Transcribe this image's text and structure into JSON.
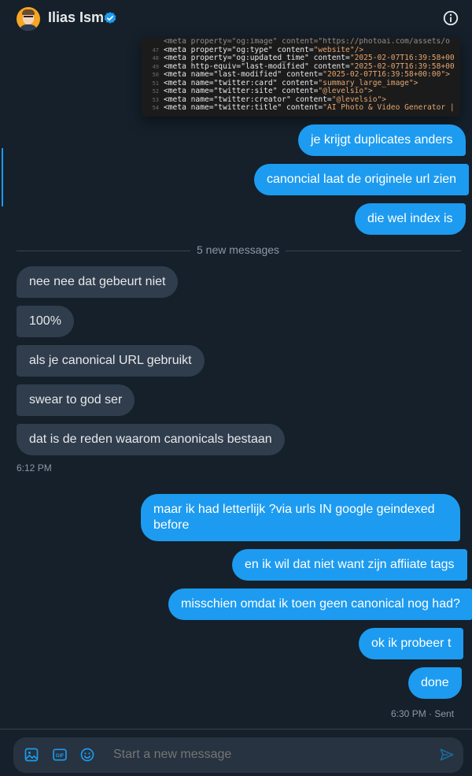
{
  "header": {
    "user_name": "Ilias Ism",
    "verified_icon": "verified-badge-icon",
    "info_icon": "info-icon",
    "accent": "#1d9bf0"
  },
  "code_snippet": {
    "lines": [
      {
        "num": "47",
        "tag": "<meta property=\"og:type\" content=",
        "value": "\"website\"/>"
      },
      {
        "num": "48",
        "tag": "<meta property=\"og:updated_time\" content=",
        "value": "\"2025-02-07T16:39:58+00"
      },
      {
        "num": "49",
        "tag": "<meta http-equiv=\"last-modified\" content=",
        "value": "\"2025-02-07T16:39:58+00"
      },
      {
        "num": "50",
        "tag": "<meta name=\"last-modified\" content=",
        "value": "\"2025-02-07T16:39:58+00:00\">"
      },
      {
        "num": "51",
        "tag": "<meta name=\"twitter:card\" content=",
        "value": "\"summary_large_image\">"
      },
      {
        "num": "52",
        "tag": "<meta name=\"twitter:site\" content=",
        "value": "\"@levelsio\">"
      },
      {
        "num": "53",
        "tag": "<meta name=\"twitter:creator\" content=",
        "value": "\"@levelsio\">"
      },
      {
        "num": "54",
        "tag": "<meta name=\"twitter:title\" content=",
        "value": "\"AI Photo & Video Generator |"
      }
    ]
  },
  "messages_top": [
    "je krijgt duplicates anders",
    "canoncial laat de originele url zien",
    "die wel index is"
  ],
  "divider_label": "5 new messages",
  "messages_in": [
    "nee nee dat gebeurt niet",
    "100%",
    "als je canonical URL gebruikt",
    "swear to god ser",
    "dat is de reden waarom canonicals bestaan"
  ],
  "in_timestamp": "6:12 PM",
  "messages_out": [
    "maar ik had letterlijk ?via urls IN google geindexed before",
    "en ik wil dat niet want zijn affiiate tags",
    "misschien omdat ik toen geen canonical nog had?",
    "ok ik probeer t",
    "done"
  ],
  "out_timestamp": "6:30 PM · Sent",
  "composer": {
    "placeholder": "Start a new message",
    "icons": [
      "image-icon",
      "gif-icon",
      "emoji-icon",
      "send-icon"
    ]
  }
}
